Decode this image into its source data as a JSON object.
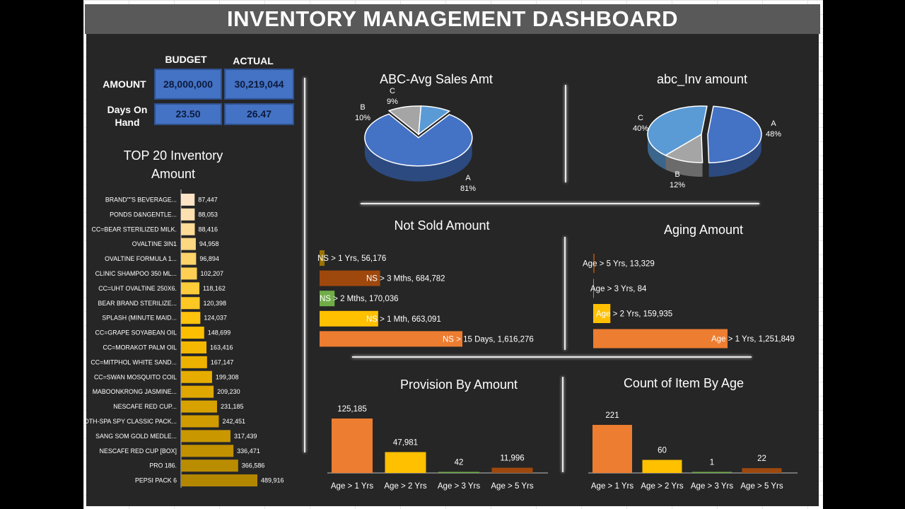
{
  "title": "INVENTORY MANAGEMENT DASHBOARD",
  "kpi": {
    "col_budget": "BUDGET",
    "col_actual": "ACTUAL",
    "row_amount": "AMOUNT",
    "row_days_line1": "Days On",
    "row_days_line2": "Hand",
    "amount_budget": "28,000,000",
    "amount_actual": "30,219,044",
    "days_budget": "23.50",
    "days_actual": "26.47"
  },
  "colors": {
    "orange": "#ed7d31",
    "gold": "#ffc000",
    "brown": "#9e480e",
    "green": "#70ad47",
    "olive": "#997300",
    "blue": "#4472c4",
    "lightblue": "#5b9bd5",
    "gray": "#a5a5a5"
  },
  "chart_data": [
    {
      "type": "bar",
      "orientation": "horizontal",
      "title": "TOP 20 Inventory Amount",
      "title_line1": "TOP 20 Inventory",
      "title_line2": "Amount",
      "categories": [
        "BRAND\"\"S BEVERAGE...",
        "PONDS D&NGENTLE...",
        "CC=BEAR STERILIZED MILK.",
        "OVALTINE 3IN1",
        "OVALTINE FORMULA 1...",
        "CLINIC SHAMPOO 350 ML...",
        "CC=UHT OVALTINE 250X6.",
        "BEAR BRAND STERILIZE...",
        "SPLASH (MINUTE MAID...",
        "CC=GRAPE SOYABEAN OIL",
        "CC=MORAKOT PALM OIL",
        "CC=MITPHOL WHITE SAND...",
        "CC=SWAN MOSQUITO COIL",
        "MABOONKRONG JASMINE...",
        "NESCAFE RED CUP...",
        "OTH-SPA SPY CLASSIC PACK...",
        "SANG SOM GOLD MEDLE...",
        "NESCAFE RED CUP [BOX]",
        "PRO 186.",
        "PEPSI PACK 6"
      ],
      "values": [
        87447,
        88053,
        88416,
        94958,
        96894,
        102207,
        118162,
        120398,
        124037,
        148699,
        163416,
        167147,
        199308,
        209230,
        231185,
        242451,
        317439,
        336471,
        366586,
        489916
      ],
      "value_labels": [
        "87,447",
        "88,053",
        "88,416",
        "94,958",
        "96,894",
        "102,207",
        "118,162",
        "120,398",
        "124,037",
        "148,699",
        "163,416",
        "167,147",
        "199,308",
        "209,230",
        "231,185",
        "242,451",
        "317,439",
        "336,471",
        "366,586",
        "489,916"
      ]
    },
    {
      "type": "pie",
      "title": "ABC-Avg Sales Amt",
      "slices": [
        {
          "label": "A",
          "value": 81,
          "pct": "81%",
          "color": "#4472c4"
        },
        {
          "label": "B",
          "value": 10,
          "pct": "10%",
          "color": "#a5a5a5"
        },
        {
          "label": "C",
          "value": 9,
          "pct": "9%",
          "color": "#5b9bd5"
        }
      ]
    },
    {
      "type": "pie",
      "title": "abc_Inv amount",
      "slices": [
        {
          "label": "A",
          "value": 48,
          "pct": "48%",
          "color": "#4472c4"
        },
        {
          "label": "B",
          "value": 12,
          "pct": "12%",
          "color": "#a5a5a5"
        },
        {
          "label": "C",
          "value": 40,
          "pct": "40%",
          "color": "#5b9bd5"
        }
      ]
    },
    {
      "type": "bar",
      "orientation": "horizontal",
      "title": "Not Sold Amount",
      "categories": [
        "NS > 1 Yrs",
        "NS > 3 Mths",
        "NS > 2 Mths",
        "NS > 1 Mth",
        "NS > 15 Days"
      ],
      "values": [
        56176,
        684782,
        170036,
        663091,
        1616276
      ],
      "labels": [
        "NS > 1 Yrs, 56,176",
        "NS > 3 Mths, 684,782",
        "NS > 2 Mths, 170,036",
        "NS > 1 Mth, 663,091",
        "NS > 15 Days, 1,616,276"
      ],
      "colors": [
        "#997300",
        "#9e480e",
        "#70ad47",
        "#ffc000",
        "#ed7d31"
      ]
    },
    {
      "type": "bar",
      "orientation": "horizontal",
      "title": "Aging Amount",
      "categories": [
        "Age >  5 Yrs",
        "Age > 3 Yrs",
        "Age >  2 Yrs",
        "Age > 1 Yrs"
      ],
      "values": [
        13329,
        84,
        159935,
        1251849
      ],
      "labels": [
        "Age >  5 Yrs, 13,329",
        "Age > 3 Yrs, 84",
        "Age >  2 Yrs, 159,935",
        "Age > 1 Yrs, 1,251,849"
      ],
      "colors": [
        "#9e480e",
        "#70ad47",
        "#ffc000",
        "#ed7d31"
      ]
    },
    {
      "type": "bar",
      "title": "Provision By Amount",
      "categories": [
        "Age > 1 Yrs",
        "Age >  2 Yrs",
        "Age > 3 Yrs",
        "Age >  5 Yrs"
      ],
      "values": [
        125185,
        47981,
        42,
        11996
      ],
      "value_labels": [
        "125,185",
        "47,981",
        "42",
        "11,996"
      ],
      "colors": [
        "#ed7d31",
        "#ffc000",
        "#70ad47",
        "#9e480e"
      ]
    },
    {
      "type": "bar",
      "title": "Count of Item By Age",
      "categories": [
        "Age > 1 Yrs",
        "Age >  2 Yrs",
        "Age > 3 Yrs",
        "Age >  5 Yrs"
      ],
      "values": [
        221,
        60,
        1,
        22
      ],
      "value_labels": [
        "221",
        "60",
        "1",
        "22"
      ],
      "colors": [
        "#ed7d31",
        "#ffc000",
        "#70ad47",
        "#9e480e"
      ]
    }
  ]
}
